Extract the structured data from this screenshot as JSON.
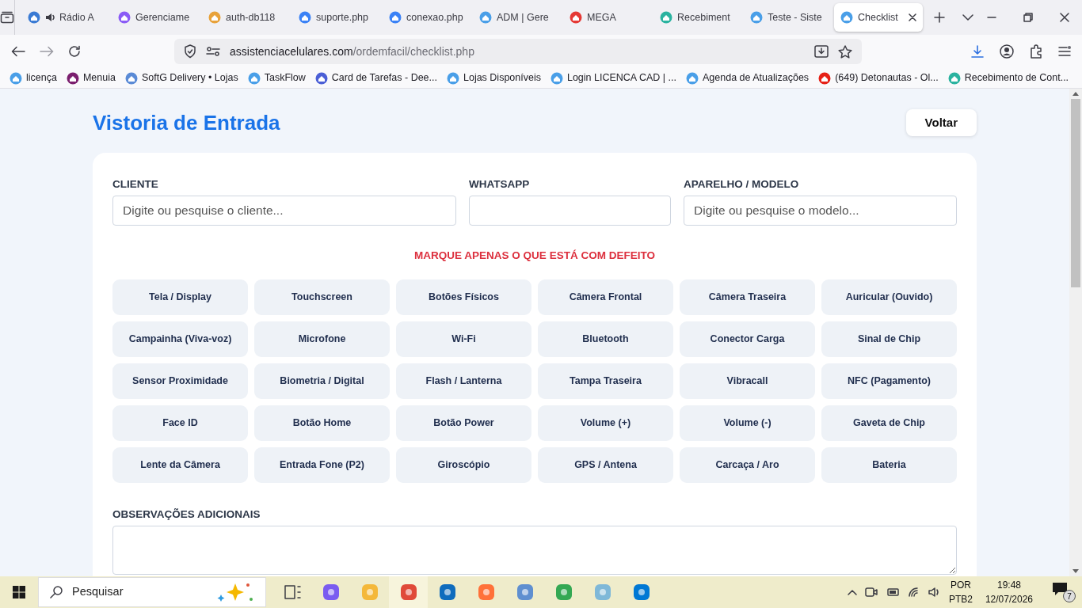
{
  "browser": {
    "tabs": [
      {
        "title": "Rádio A",
        "selected": false,
        "audio": true,
        "color": "#3b7bd4"
      },
      {
        "title": "Gerenciame",
        "selected": false,
        "audio": false,
        "color": "#8b5cf6"
      },
      {
        "title": "auth-db118",
        "selected": false,
        "audio": false,
        "color": "#e8a23a"
      },
      {
        "title": "suporte.php",
        "selected": false,
        "audio": false,
        "color": "#3b82f6"
      },
      {
        "title": "conexao.php",
        "selected": false,
        "audio": false,
        "color": "#3b82f6"
      },
      {
        "title": "ADM | Gere",
        "selected": false,
        "audio": false,
        "color": "#4a9fe8"
      },
      {
        "title": "MEGA",
        "selected": false,
        "audio": false,
        "color": "#e53935"
      },
      {
        "title": "Recebiment",
        "selected": false,
        "audio": false,
        "color": "#2bb3a0"
      },
      {
        "title": "Teste - Siste",
        "selected": false,
        "audio": false,
        "color": "#4a9fe8"
      },
      {
        "title": "Checklist",
        "selected": true,
        "audio": false,
        "color": "#4a9fe8"
      }
    ],
    "address": {
      "domain": "assistenciacelulares.com",
      "path": "/ordemfacil/checklist.php"
    },
    "bookmarks": [
      {
        "label": "licença",
        "color": "#4a9fe8"
      },
      {
        "label": "Menuia",
        "color": "#7b1f6e"
      },
      {
        "label": "SoftG Delivery • Lojas",
        "color": "#5b8bd6"
      },
      {
        "label": "TaskFlow",
        "color": "#4a9fe8"
      },
      {
        "label": "Card de Tarefas - Dee...",
        "color": "#4b5fd6"
      },
      {
        "label": "Lojas Disponíveis",
        "color": "#4a9fe8"
      },
      {
        "label": "Login LICENCA CAD  | ...",
        "color": "#4a9fe8"
      },
      {
        "label": "Agenda de Atualizações",
        "color": "#4a9fe8"
      },
      {
        "label": "(649) Detonautas - Ol...",
        "color": "#e62117"
      },
      {
        "label": "Recebimento de Cont...",
        "color": "#2bb3a0"
      }
    ]
  },
  "page": {
    "title": "Vistoria de Entrada",
    "back_button": "Voltar",
    "fields": [
      {
        "label": "CLIENTE",
        "placeholder": "Digite ou pesquise o cliente..."
      },
      {
        "label": "WHATSAPP"
      },
      {
        "label": "APARELHO / MODELO",
        "placeholder": "Digite ou pesquise o modelo..."
      }
    ],
    "defects_heading": "MARQUE APENAS O QUE ESTÁ COM DEFEITO",
    "defects": [
      "Tela / Display",
      "Touchscreen",
      "Botões Físicos",
      "Câmera Frontal",
      "Câmera Traseira",
      "Auricular (Ouvido)",
      "Campainha (Viva-voz)",
      "Microfone",
      "Wi-Fi",
      "Bluetooth",
      "Conector Carga",
      "Sinal de Chip",
      "Sensor Proximidade",
      "Biometria / Digital",
      "Flash / Lanterna",
      "Tampa Traseira",
      "Vibracall",
      "NFC (Pagamento)",
      "Face ID",
      "Botão Home",
      "Botão Power",
      "Volume (+)",
      "Volume (-)",
      "Gaveta de Chip",
      "Lente da Câmera",
      "Entrada Fone (P2)",
      "Giroscópio",
      "GPS / Antena",
      "Carcaça / Aro",
      "Bateria"
    ],
    "notes_label": "OBSERVAÇÕES ADICIONAIS"
  },
  "taskbar": {
    "search_placeholder": "Pesquisar",
    "language": "POR",
    "layout": "PTB2",
    "time": "19:48",
    "date": "12/07/2026",
    "notifications": "7"
  }
}
